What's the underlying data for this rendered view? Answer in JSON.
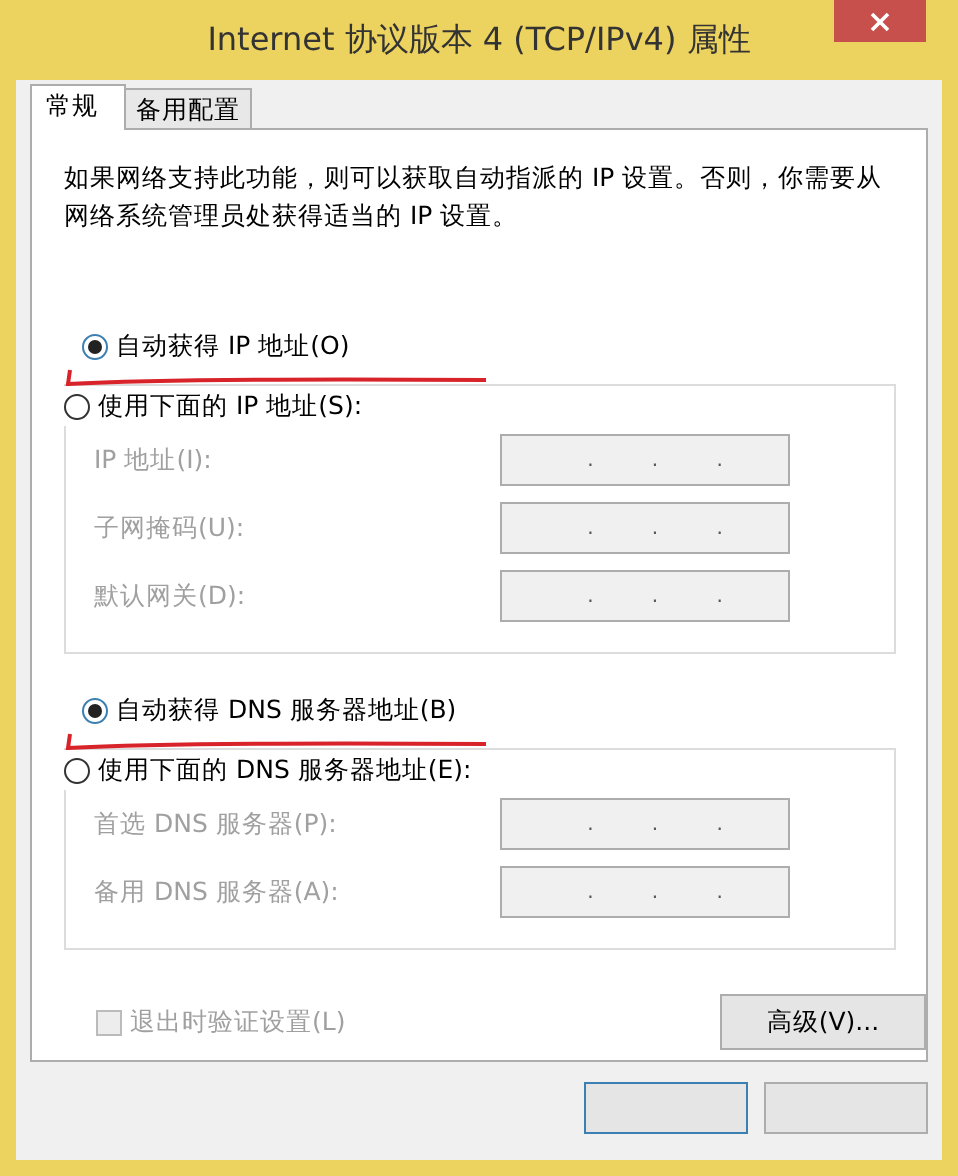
{
  "window": {
    "title": "Internet 协议版本 4 (TCP/IPv4) 属性"
  },
  "tabs": [
    {
      "label": "常规",
      "selected": true
    },
    {
      "label": "备用配置",
      "selected": false
    }
  ],
  "description": "如果网络支持此功能，则可以获取自动指派的 IP 设置。否则，你需要从网络系统管理员处获得适当的 IP 设置。",
  "sections": [
    {
      "options": [
        {
          "label": "自动获得 IP 地址(O)",
          "selected": true,
          "highlighted": true
        },
        {
          "label": "使用下面的 IP 地址(S):",
          "selected": false,
          "highlighted": false
        }
      ],
      "fields": [
        {
          "label": "IP 地址(I):",
          "disabled": true,
          "dots": [
            ".",
            ".",
            "."
          ]
        },
        {
          "label": "子网掩码(U):",
          "disabled": true,
          "dots": [
            ".",
            ".",
            "."
          ]
        },
        {
          "label": "默认网关(D):",
          "disabled": true,
          "dots": [
            ".",
            ".",
            "."
          ]
        }
      ]
    },
    {
      "options": [
        {
          "label": "自动获得 DNS 服务器地址(B)",
          "selected": true,
          "highlighted": true
        },
        {
          "label": "使用下面的 DNS 服务器地址(E):",
          "selected": false,
          "highlighted": false
        }
      ],
      "fields": [
        {
          "label": "首选 DNS 服务器(P):",
          "disabled": true,
          "dots": [
            ".",
            ".",
            "."
          ]
        },
        {
          "label": "备用 DNS 服务器(A):",
          "disabled": true,
          "dots": [
            ".",
            ".",
            "."
          ]
        }
      ]
    }
  ],
  "validate": {
    "label": "退出时验证设置(L)",
    "checked": false,
    "disabled": true
  },
  "advanced_button": "高级(V)...",
  "dialog_buttons": [
    {
      "default": true
    },
    {
      "default": false
    }
  ]
}
